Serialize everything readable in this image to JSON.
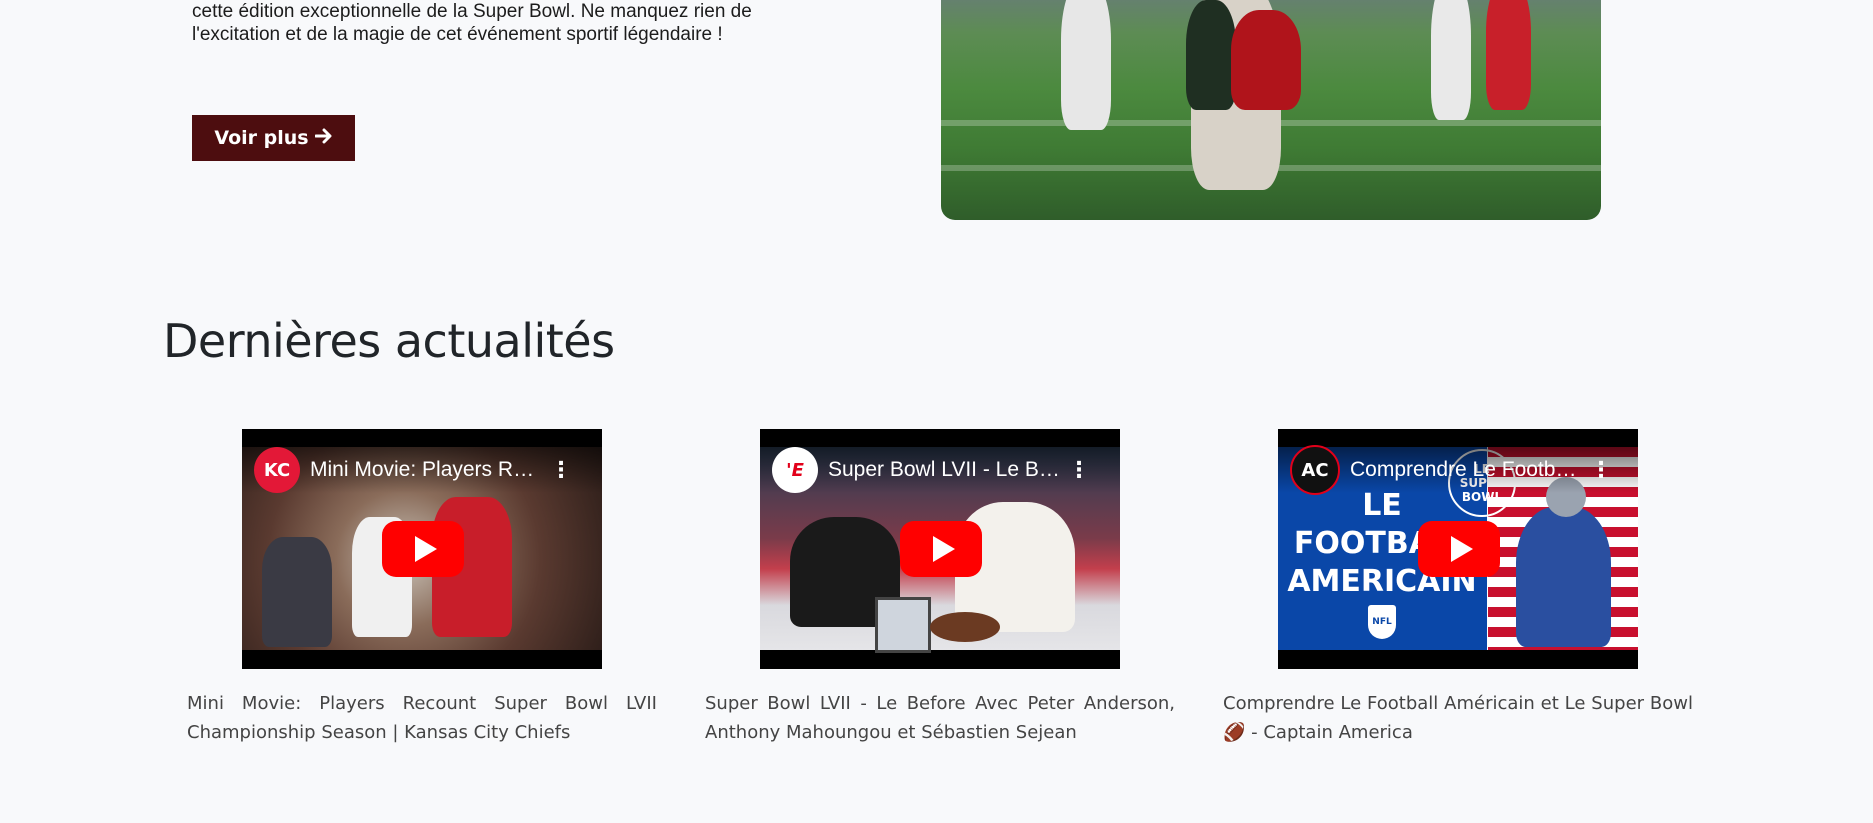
{
  "hero": {
    "text": "cette édition exceptionnelle de la Super Bowl. Ne manquez rien de l'excitation et de la magie de cet événement sportif légendaire !",
    "button_label": "Voir plus",
    "button_icon": "arrow-right-icon"
  },
  "news": {
    "title": "Dernières actualités",
    "videos": [
      {
        "channel_badge": "KC",
        "video_title": "Mini Movie: Players Recount Super Bowl LVII Championship Season | Kansas City Chiefs",
        "caption": "Mini Movie: Players Recount Super Bowl LVII Championship Season | Kansas City Chiefs",
        "colors": {
          "badge_bg": "#e31837",
          "badge_fg": "#ffffff"
        }
      },
      {
        "channel_badge": "'E",
        "video_title": "Super Bowl LVII - Le Before Avec Peter Anderson, Anthony Mahoungou et Sébastien Sejean",
        "caption": "Super Bowl LVII - Le Before Avec Peter Anderson, Anthony Mahoungou et Sébastien Sejean",
        "colors": {
          "badge_bg": "#ffffff",
          "badge_fg": "#e2001a"
        }
      },
      {
        "channel_badge": "AC",
        "video_title": "Comprendre Le Football Américain et Le Super Bowl 🏈 - Captain America",
        "caption": "Comprendre Le Football Américain et Le Super Bowl 🏈 - Captain America",
        "thumb_text": "LE FOOTBALL AMERICAIN",
        "thumb_badge": "LE SUPER BOWL",
        "thumb_logo": "NFL",
        "colors": {
          "badge_bg": "#111111",
          "badge_fg": "#ffffff"
        }
      }
    ]
  },
  "colors": {
    "page_bg": "#f8f9fb",
    "button_bg": "#4d0d0f",
    "youtube_red": "#ff0000"
  }
}
